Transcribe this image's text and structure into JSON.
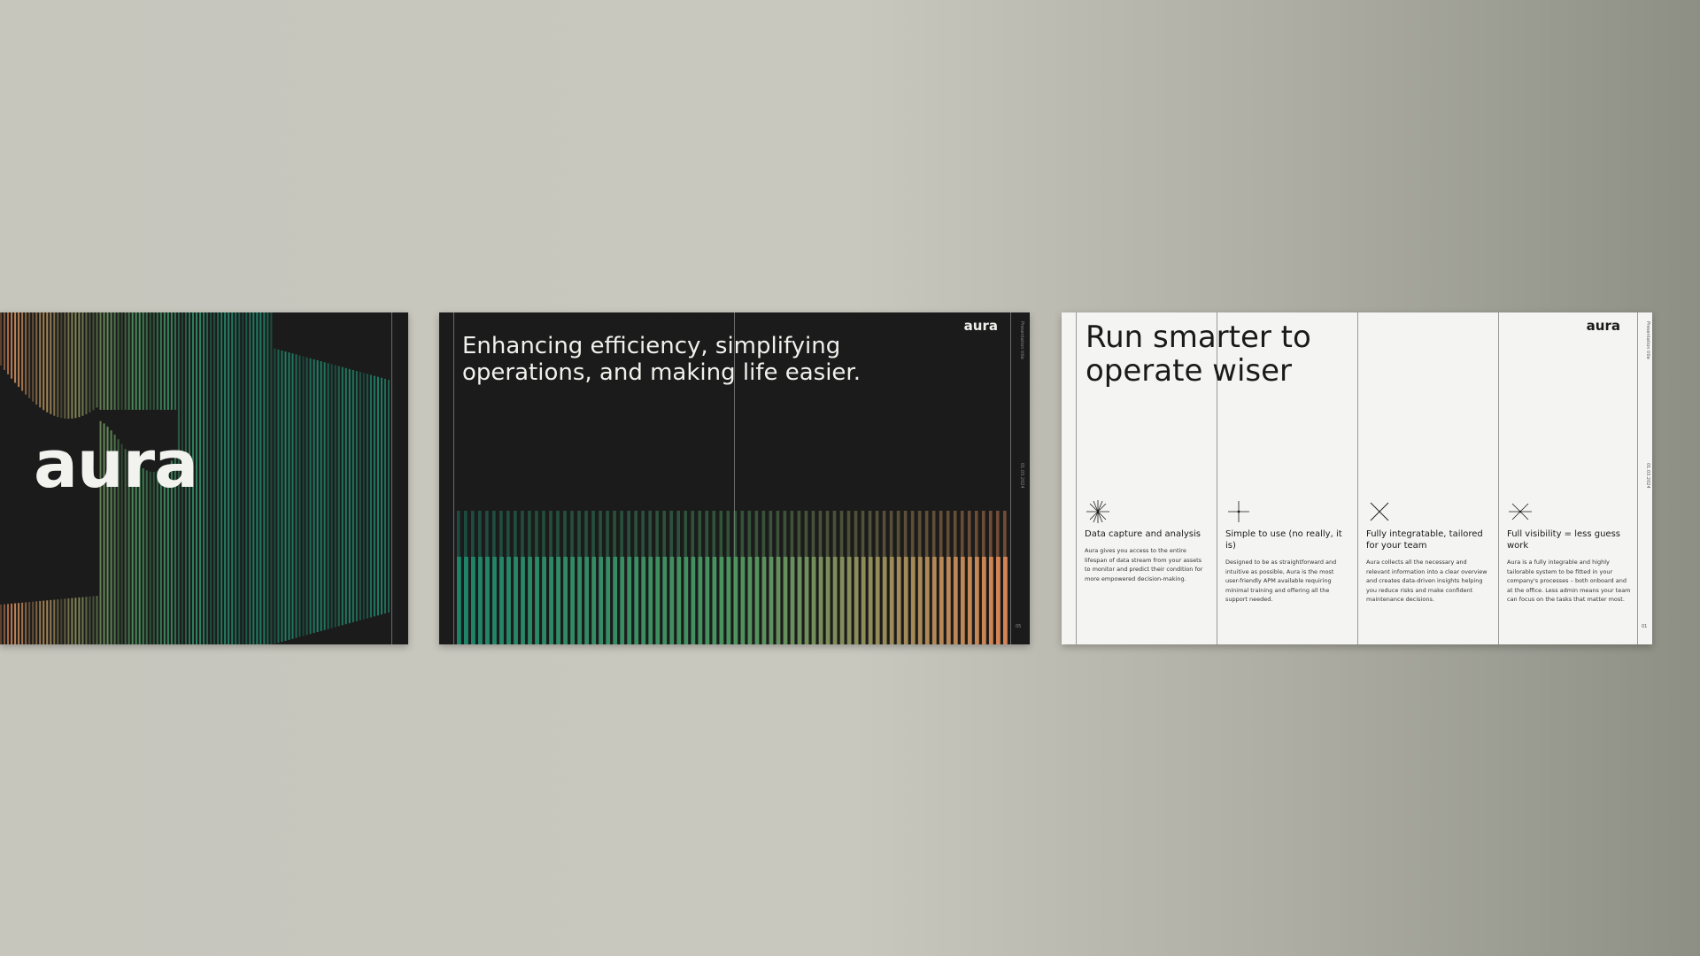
{
  "slides": [
    {
      "id": "cover",
      "theme": "dark",
      "logo_text": "aura"
    },
    {
      "id": "intro",
      "theme": "dark",
      "heading": "Enhancing efficiency, simplifying operations, and making life easier.",
      "logo_text": "aura",
      "rail_title": "Presentation title",
      "rail_date": "01.03.2024",
      "page_number": "05"
    },
    {
      "id": "features",
      "theme": "light",
      "heading": "Run smarter to operate wiser",
      "logo_text": "aura",
      "rail_title": "Presentation title",
      "rail_date": "01.03.2024",
      "page_number": "01",
      "features": [
        {
          "icon": "asterisk-icon",
          "title": "Data capture and analysis",
          "description": "Aura gives you access to the entire lifespan of data stream from your assets to monitor and predict their condition for more empowered decision-making."
        },
        {
          "icon": "crosshair-icon",
          "title": "Simple to use (no really, it is)",
          "description": "Designed to be as straightforward and intuitive as possible, Aura is the most user-friendly APM available requiring minimal training and offering all the support needed."
        },
        {
          "icon": "x-cross-icon",
          "title": "Fully integratable, tailored for your team",
          "description": "Aura collects all the necessary and relevant information into a clear overview and creates data-driven insights helping you reduce risks and make confident maintenance decisions."
        },
        {
          "icon": "star-burst-icon",
          "title": "Full visibility = less guess work",
          "description": "Aura is a fully integrable and highly tailorable system to be fitted in your company's processes – both onboard and at the office. Less admin means your team can focus on the tasks that matter most."
        }
      ]
    }
  ],
  "colors": {
    "teal": "#1f8a6e",
    "green": "#4d9a62",
    "orange": "#e08a58",
    "dark_bg": "#1b1b1b",
    "light_bg": "#f4f4f2"
  }
}
